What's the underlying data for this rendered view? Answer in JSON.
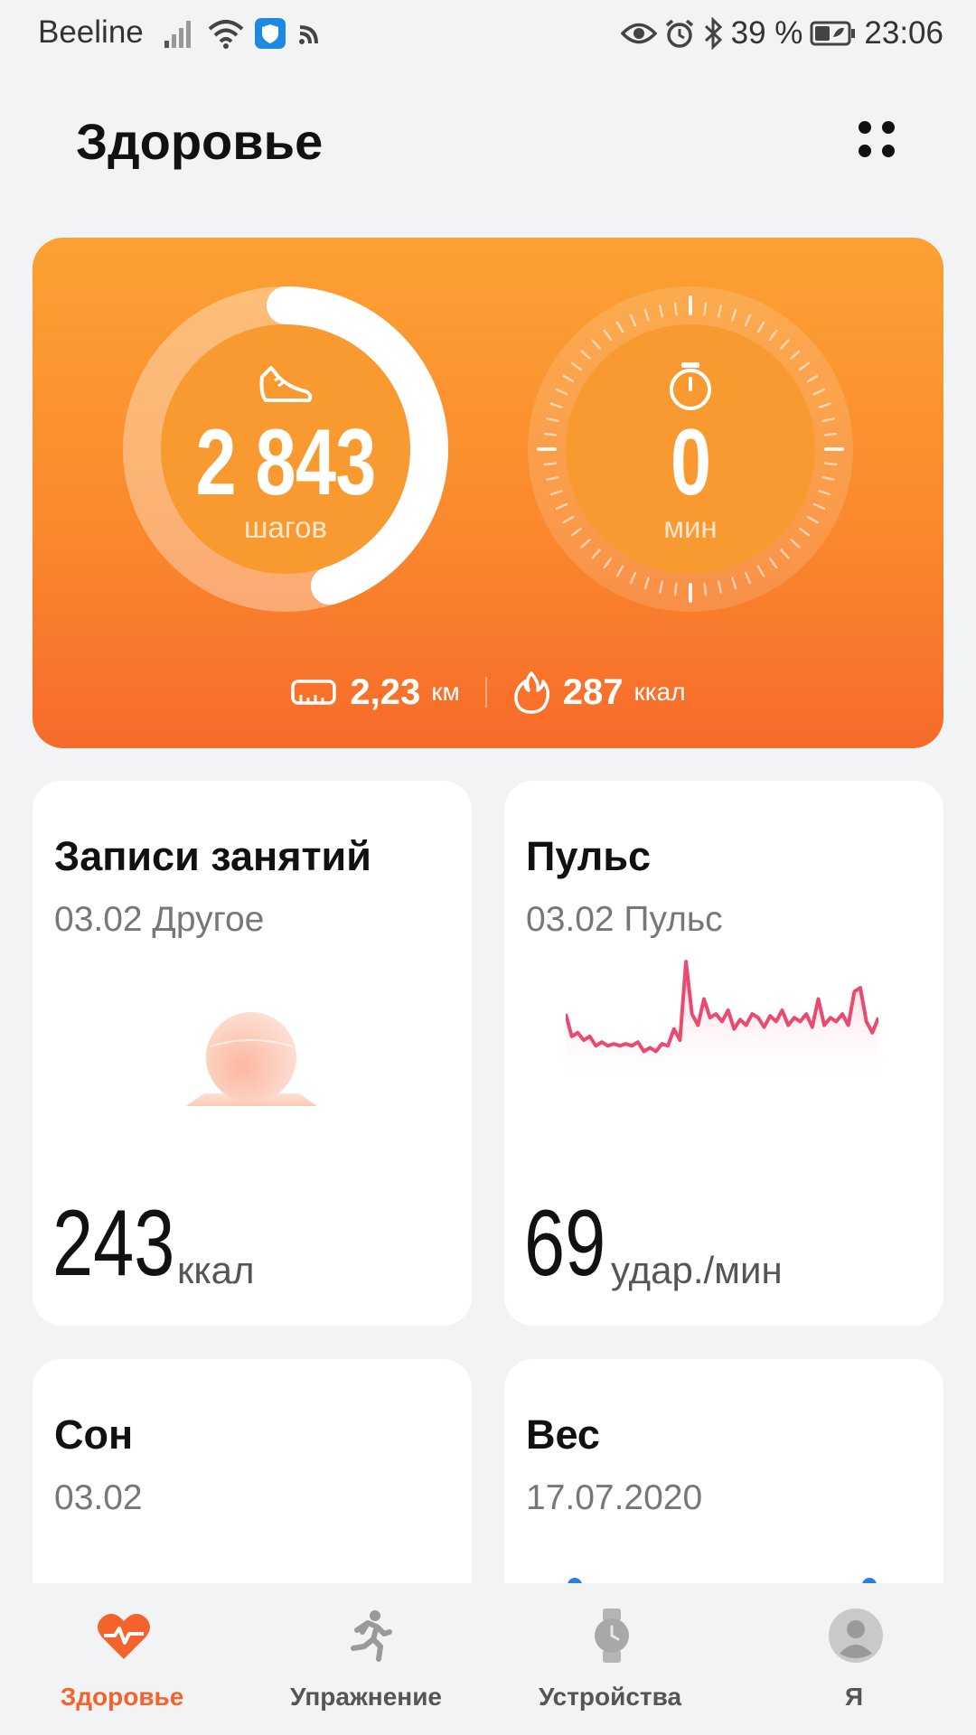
{
  "status_bar": {
    "carrier": "Beeline",
    "battery": "39 %",
    "time": "23:06"
  },
  "header": {
    "title": "Здоровье"
  },
  "activity": {
    "steps_value": "2 843",
    "steps_unit": "шагов",
    "steps_progress": 0.45,
    "minutes_value": "0",
    "minutes_unit": "мин",
    "distance_value": "2,23",
    "distance_unit": "км",
    "calories_value": "287",
    "calories_unit": "ккал"
  },
  "cards": {
    "workouts": {
      "title": "Записи занятий",
      "subtitle": "03.02 Другое",
      "value": "243",
      "unit": "ккал"
    },
    "pulse": {
      "title": "Пульс",
      "subtitle": "03.02 Пульс",
      "value": "69",
      "unit": "удар./мин",
      "sparkline": [
        72,
        60,
        62,
        58,
        60,
        55,
        57,
        55,
        56,
        55,
        56,
        55,
        57,
        52,
        54,
        52,
        56,
        55,
        64,
        58,
        100,
        72,
        66,
        80,
        70,
        72,
        68,
        74,
        64,
        69,
        66,
        72,
        70,
        65,
        71,
        68,
        74,
        66,
        70,
        68,
        72,
        65,
        80,
        66,
        70,
        68,
        72,
        66,
        84,
        86,
        68,
        62,
        70
      ]
    },
    "sleep": {
      "title": "Сон",
      "subtitle": "03.02"
    },
    "weight": {
      "title": "Вес",
      "subtitle": "17.07.2020"
    }
  },
  "colors": {
    "accent": "#f4632b",
    "hero_top": "#fca133",
    "hero_bottom": "#f76a2a",
    "pulse_line": "#ea4a6f"
  },
  "nav": {
    "items": [
      {
        "label": "Здоровье",
        "icon": "heart-pulse-icon",
        "active": true
      },
      {
        "label": "Упражнение",
        "icon": "runner-icon",
        "active": false
      },
      {
        "label": "Устройства",
        "icon": "watch-icon",
        "active": false
      },
      {
        "label": "Я",
        "icon": "profile-icon",
        "active": false
      }
    ]
  }
}
